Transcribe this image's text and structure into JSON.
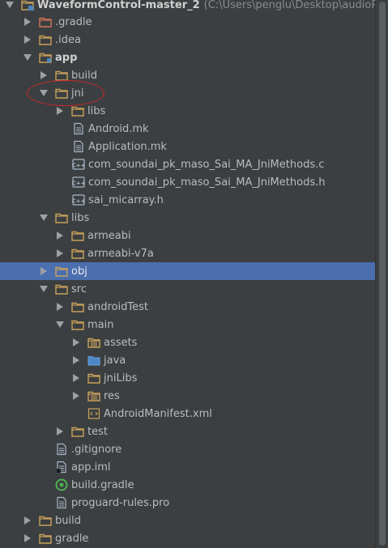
{
  "project": {
    "name": "WaveformControl-master_2",
    "path": "(C:\\Users\\penglu\\Desktop\\audioReco"
  },
  "tree": {
    "gradle_dir": ".gradle",
    "idea_dir": ".idea",
    "app": "app",
    "build": "build",
    "jni": "jni",
    "jni_libs": "libs",
    "android_mk": "Android.mk",
    "application_mk": "Application.mk",
    "jni_c": "com_soundai_pk_maso_Sai_MA_JniMethods.c",
    "jni_h": "com_soundai_pk_maso_Sai_MA_JniMethods.h",
    "micarray_h": "sai_micarray.h",
    "libs": "libs",
    "armeabi": "armeabi",
    "armeabi_v7a": "armeabi-v7a",
    "obj": "obj",
    "src": "src",
    "android_test": "androidTest",
    "main": "main",
    "assets": "assets",
    "java": "java",
    "jnilibs": "jniLibs",
    "res": "res",
    "manifest": "AndroidManifest.xml",
    "test": "test",
    "gitignore": ".gitignore",
    "app_iml": "app.iml",
    "build_gradle": "build.gradle",
    "proguard": "proguard-rules.pro",
    "root_build": "build",
    "root_gradle": "gradle"
  },
  "colors": {
    "background": "#3c3f41",
    "selection": "#4b6eaf",
    "folder": "#c8a25a",
    "highlight_circle": "#c8282a"
  }
}
